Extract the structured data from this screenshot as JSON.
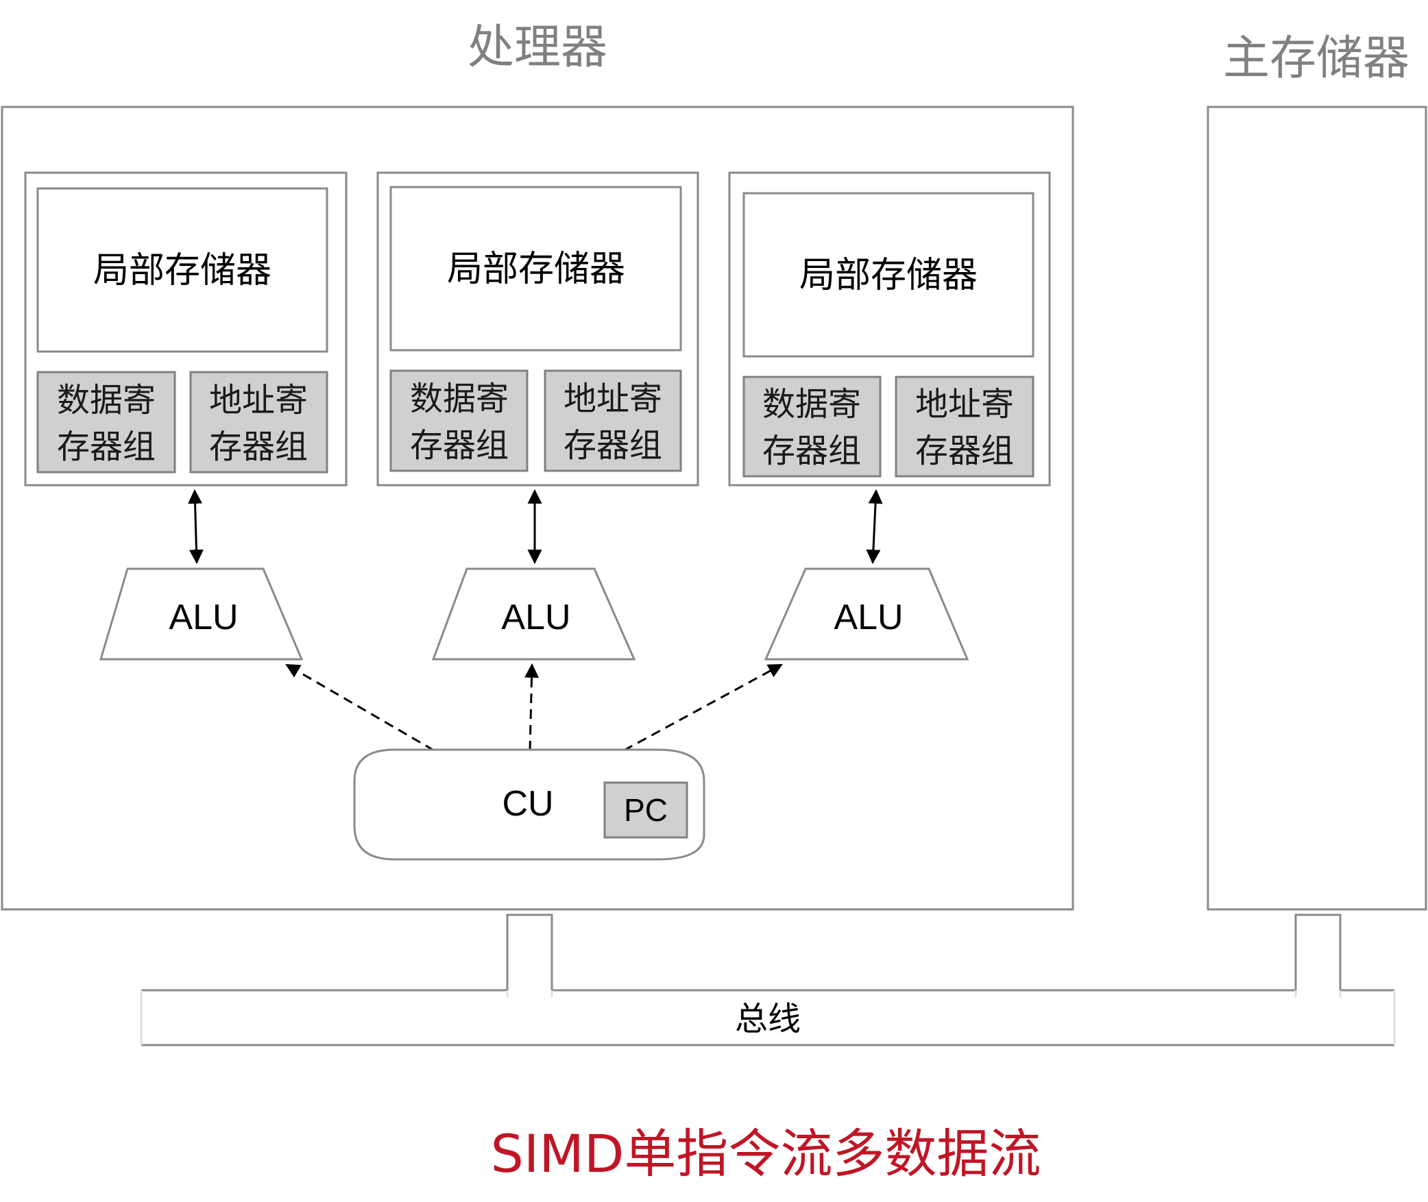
{
  "labels": {
    "processor": "处理器",
    "main_memory": "主存储器",
    "local_memory": "局部存储器",
    "data_reg_line1": "数据寄",
    "data_reg_line2": "存器组",
    "addr_reg_line1": "地址寄",
    "addr_reg_line2": "存器组",
    "alu": "ALU",
    "cu": "CU",
    "pc": "PC",
    "bus": "总线",
    "title": "SIMD单指令流多数据流"
  },
  "colors": {
    "border": "#8a8a8a",
    "register_fill": "#d0d0d0",
    "heading_text": "#808080",
    "title_text": "#c01525"
  }
}
